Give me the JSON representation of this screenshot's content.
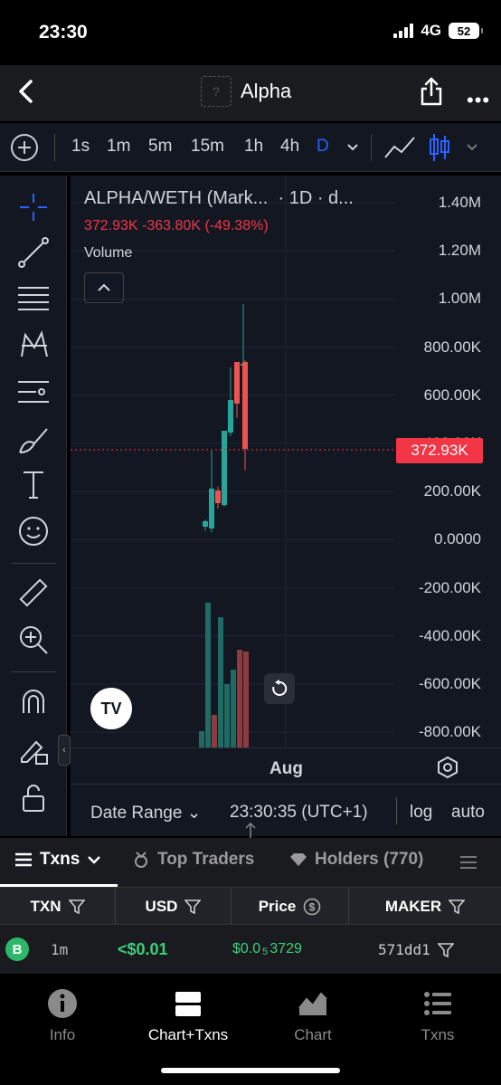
{
  "status": {
    "time": "23:30",
    "network": "4G",
    "battery": "52"
  },
  "nav": {
    "title": "Alpha",
    "token_placeholder": "?"
  },
  "timeframes": [
    "1s",
    "1m",
    "5m",
    "15m",
    "1h",
    "4h",
    "D"
  ],
  "active_timeframe": "D",
  "chart_header": {
    "pair": "ALPHA/WETH (Mark...",
    "interval": "· 1D · d...",
    "values": "372.93K  -363.80K (-49.38%)",
    "volume_label": "Volume"
  },
  "chart_data": {
    "type": "candlestick",
    "y_ticks": [
      "1.40M",
      "1.20M",
      "1.00M",
      "800.00K",
      "600.00K",
      "400.00K",
      "200.00K",
      "0.0000",
      "-200.00K",
      "-400.00K",
      "-600.00K",
      "-800.00K"
    ],
    "current_price": "372.93K",
    "current_value": 372930,
    "x_ticks": [
      "Aug"
    ],
    "up_color": "#26a69a",
    "down_color": "#ef5350"
  },
  "bottom_bar": {
    "date_range": "Date Range",
    "clock": "23:30:35 (UTC+1)",
    "log": "log",
    "auto": "auto"
  },
  "tabs": [
    {
      "label": "Txns"
    },
    {
      "label": "Top Traders"
    },
    {
      "label": "Holders (770)"
    }
  ],
  "table": {
    "headers": [
      "TXN",
      "USD",
      "Price",
      "MAKER"
    ],
    "rows": [
      {
        "type": "B",
        "age": "1m",
        "usd": "<$0.01",
        "price_prefix": "$0.0",
        "price_sub": "5",
        "price_rest": "3729",
        "maker": "571dd1"
      }
    ]
  },
  "tabbar": [
    {
      "label": "Info",
      "icon": "info-icon"
    },
    {
      "label": "Chart+Txns",
      "icon": "chart-txns-icon"
    },
    {
      "label": "Chart",
      "icon": "chart-icon"
    },
    {
      "label": "Txns",
      "icon": "list-icon"
    }
  ],
  "active_tab": "Chart+Txns"
}
